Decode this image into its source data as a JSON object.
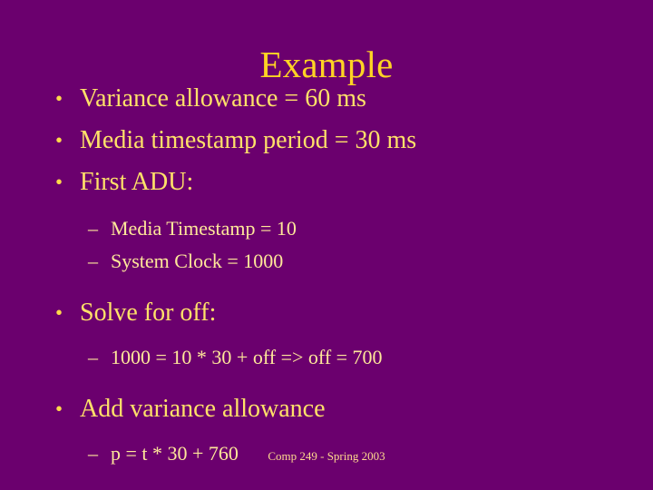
{
  "slide": {
    "title": "Example",
    "background_color": "#6b006e",
    "title_color": "#ffd324",
    "body_color": "#ffe169",
    "sub_color": "#ffe89a",
    "footer_color": "#ffd98e",
    "bullet_marker": "•",
    "dash_marker": "–",
    "content": [
      {
        "level": 1,
        "text": "Variance allowance = 60 ms"
      },
      {
        "level": 1,
        "text": "Media timestamp period = 30 ms"
      },
      {
        "level": 1,
        "text": "First ADU:"
      },
      {
        "level": 2,
        "text": "Media Timestamp = 10"
      },
      {
        "level": 2,
        "text": "System Clock = 1000"
      },
      {
        "level": 1,
        "text": "Solve for off:"
      },
      {
        "level": 2,
        "text": "1000 = 10 * 30 + off  =>  off = 700"
      },
      {
        "level": 1,
        "text": "Add variance allowance"
      },
      {
        "level": 2,
        "text": "p = t * 30 + 760"
      }
    ],
    "footer": "Comp 249 - Spring 2003"
  }
}
